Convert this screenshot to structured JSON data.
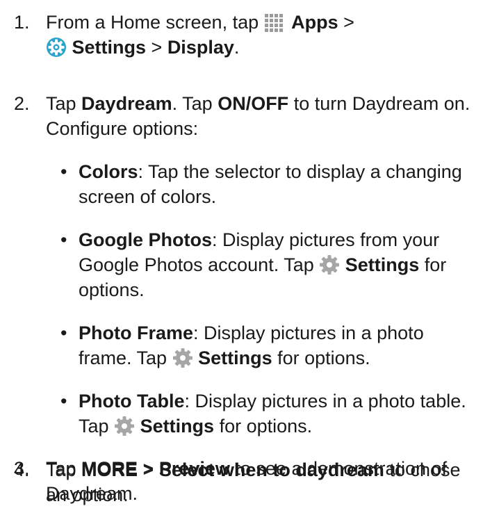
{
  "steps": [
    {
      "num": "1.",
      "t1": "From a Home screen, tap ",
      "apps": "Apps",
      "t2": " >",
      "settings": "Settings",
      "t3": " > ",
      "display": "Display",
      "t4": "."
    },
    {
      "num": "2.",
      "t1": "Tap ",
      "daydream": "Daydream",
      "t2": ". Tap ",
      "onoff": "ON/OFF",
      "t3": " to turn Daydream on. Configure options:"
    },
    {
      "num": "3.",
      "t1": "Tap ",
      "more": "MORE",
      "t2": " > ",
      "preview": "Preview",
      "t3": " to see a demonstration of Daydream."
    },
    {
      "num": "4.",
      "t1": "Tap ",
      "more": "MORE",
      "t2": " > ",
      "select": "Select when to daydream",
      "t3": " to chose an option."
    }
  ],
  "options": [
    {
      "dot": "•",
      "name": "Colors",
      "text": ": Tap the selector to display a changing screen of colors."
    },
    {
      "dot": "•",
      "name": "Google Photos",
      "text": ": Display pictures from your Google Photos account. Tap ",
      "settings": "Settings",
      "tail": " for options."
    },
    {
      "dot": "•",
      "name": "Photo Frame",
      "text": ": Display pictures in a photo frame. Tap ",
      "settings": "Settings",
      "tail": " for options."
    },
    {
      "dot": "•",
      "name": "Photo Table",
      "text": ": Display pictures in a photo table. Tap ",
      "settings": "Settings",
      "tail": " for options."
    }
  ],
  "icons": {
    "apps": "apps-grid-icon",
    "settings_round": "settings-gear-icon",
    "settings_gear": "gear-icon"
  },
  "colors": {
    "text": "#1a1a1a",
    "apps_icon": "#9a9a9a",
    "settings_teal": "#2aa4c8",
    "gear_gray": "#a6a6a6"
  }
}
